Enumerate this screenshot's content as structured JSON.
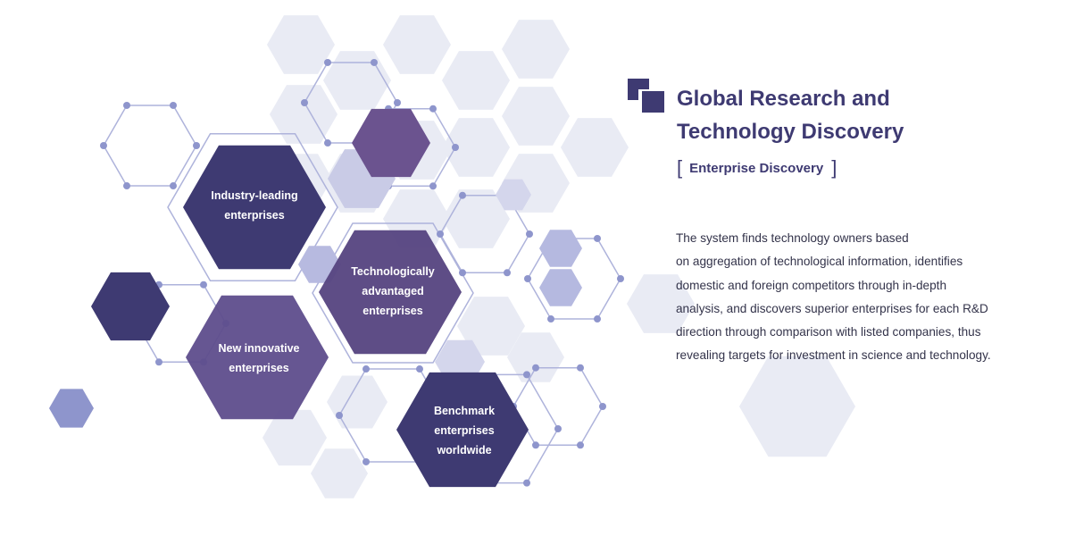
{
  "header": {
    "title_lines": [
      "Global Research and",
      "Technology Discovery"
    ],
    "subtitle": "Enterprise Discovery",
    "bracket_open": "[",
    "bracket_close": "]"
  },
  "description_lines": [
    "The system finds technology owners based",
    "on aggregation of technological information, identifies",
    "domestic and foreign competitors through in-depth",
    "analysis, and discovers superior enterprises for each R&D",
    "direction through comparison with listed companies, thus",
    "revealing targets for investment in science and technology."
  ],
  "categories": [
    {
      "id": "industry-leading",
      "lines": [
        "Industry-leading",
        "enterprises"
      ]
    },
    {
      "id": "technologically-advantaged",
      "lines": [
        "Technologically",
        "advantaged",
        "enterprises"
      ]
    },
    {
      "id": "new-innovative",
      "lines": [
        "New innovative",
        "enterprises"
      ]
    },
    {
      "id": "benchmark-worldwide",
      "lines": [
        "Benchmark",
        "enterprises",
        "worldwide"
      ]
    }
  ],
  "colors": {
    "dark": "#3e3a72",
    "medium": "#5e4d8c",
    "light_fill": "#e9ebf4",
    "node": "#8e95cc",
    "line": "#aeb3db"
  }
}
